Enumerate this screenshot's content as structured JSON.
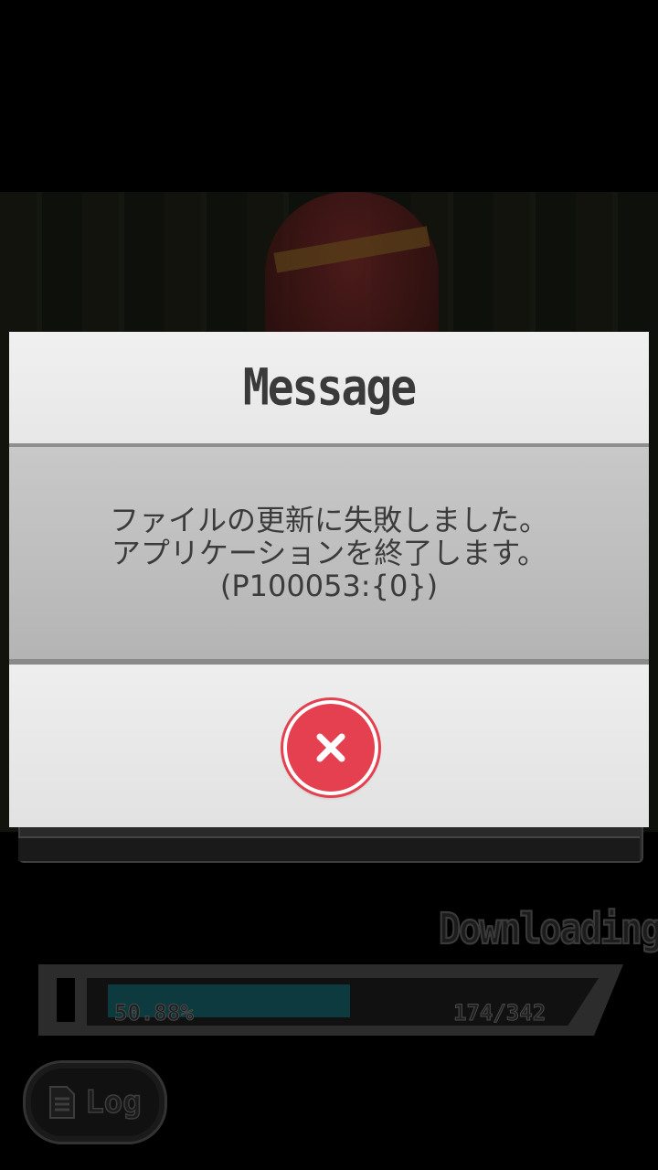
{
  "dialog": {
    "title": "Message",
    "message_lines": [
      "ファイルの更新に失敗しました。",
      "アプリケーションを終了します。",
      "(P100053:{0})"
    ],
    "close_icon": "close-x-icon"
  },
  "download": {
    "label": "Downloading",
    "progress_percent": 50.88,
    "progress_text": "50.88%",
    "count_text": "174/342"
  },
  "log_button": {
    "label": "Log",
    "icon": "document-icon"
  },
  "colors": {
    "close_button": "#e5404f",
    "progress_fill": "#0c3a3e"
  }
}
